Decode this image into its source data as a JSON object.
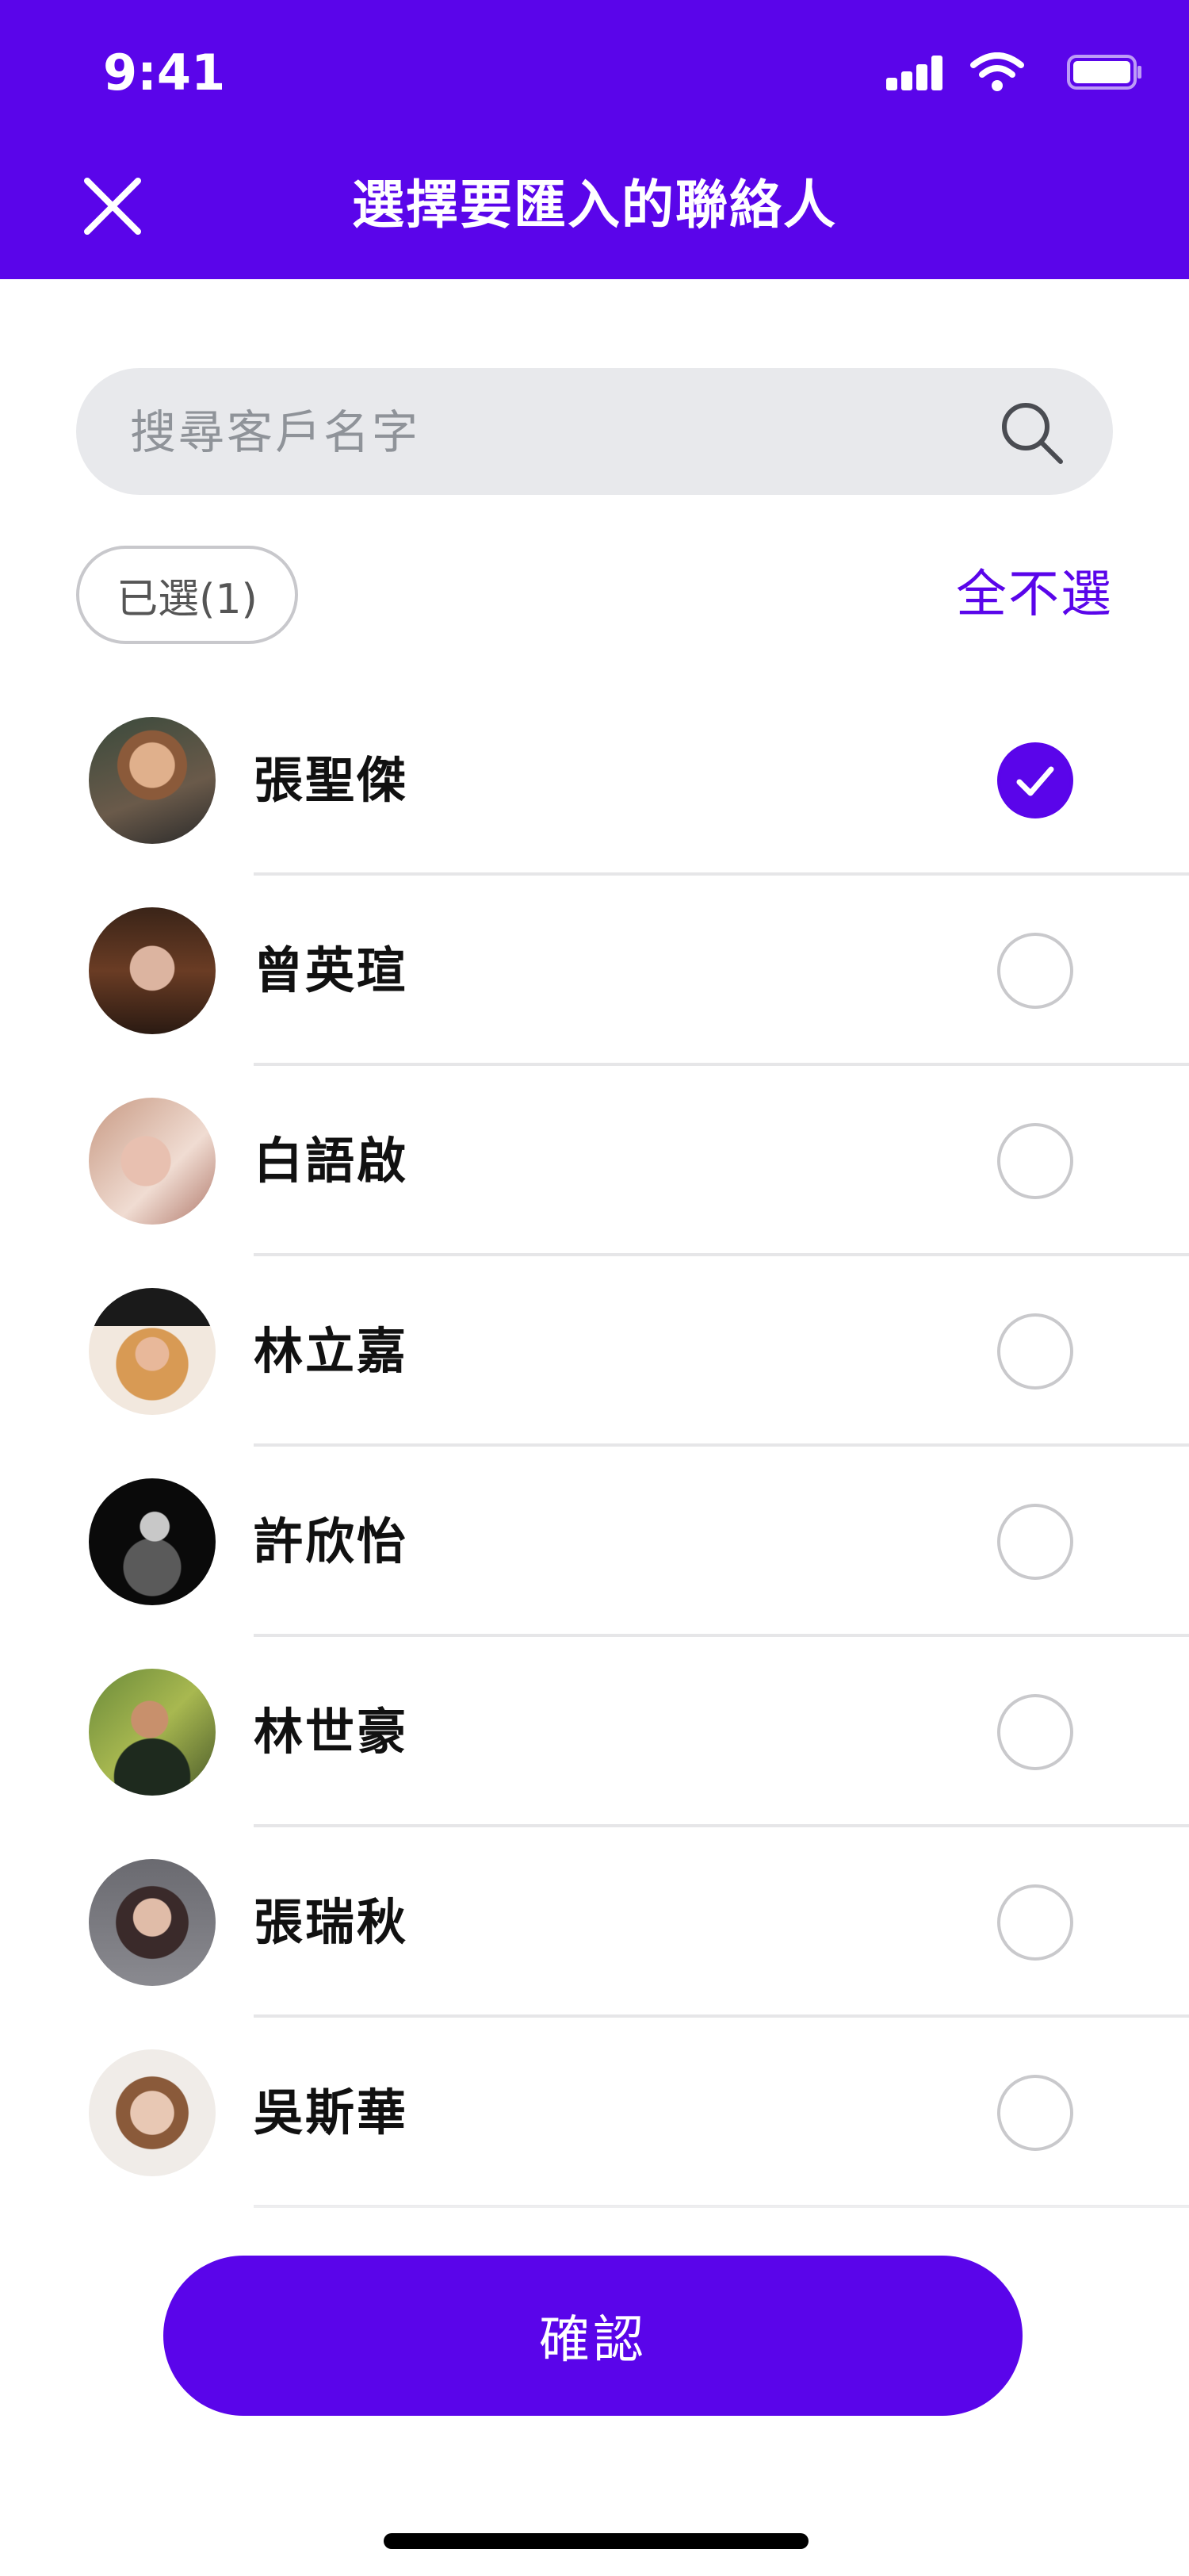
{
  "status_bar": {
    "time": "9:41"
  },
  "header": {
    "title": "選擇要匯入的聯絡人"
  },
  "search": {
    "placeholder": "搜尋客戶名字"
  },
  "selection": {
    "selected_label": "已選(1)",
    "deselect_all_label": "全不選"
  },
  "contacts": [
    {
      "name": "張聖傑",
      "checked": true
    },
    {
      "name": "曾英瑄",
      "checked": false
    },
    {
      "name": "白語啟",
      "checked": false
    },
    {
      "name": "林立嘉",
      "checked": false
    },
    {
      "name": "許欣怡",
      "checked": false
    },
    {
      "name": "林世豪",
      "checked": false
    },
    {
      "name": "張瑞秋",
      "checked": false
    },
    {
      "name": "吳斯華",
      "checked": false
    }
  ],
  "footer": {
    "confirm_label": "確認"
  },
  "colors": {
    "accent": "#5a05ea",
    "search_bg": "#e8e9ec",
    "divider": "#e6e6e8"
  },
  "icons": {
    "close": "close-icon",
    "search": "search-icon",
    "check": "checkmark-icon"
  }
}
